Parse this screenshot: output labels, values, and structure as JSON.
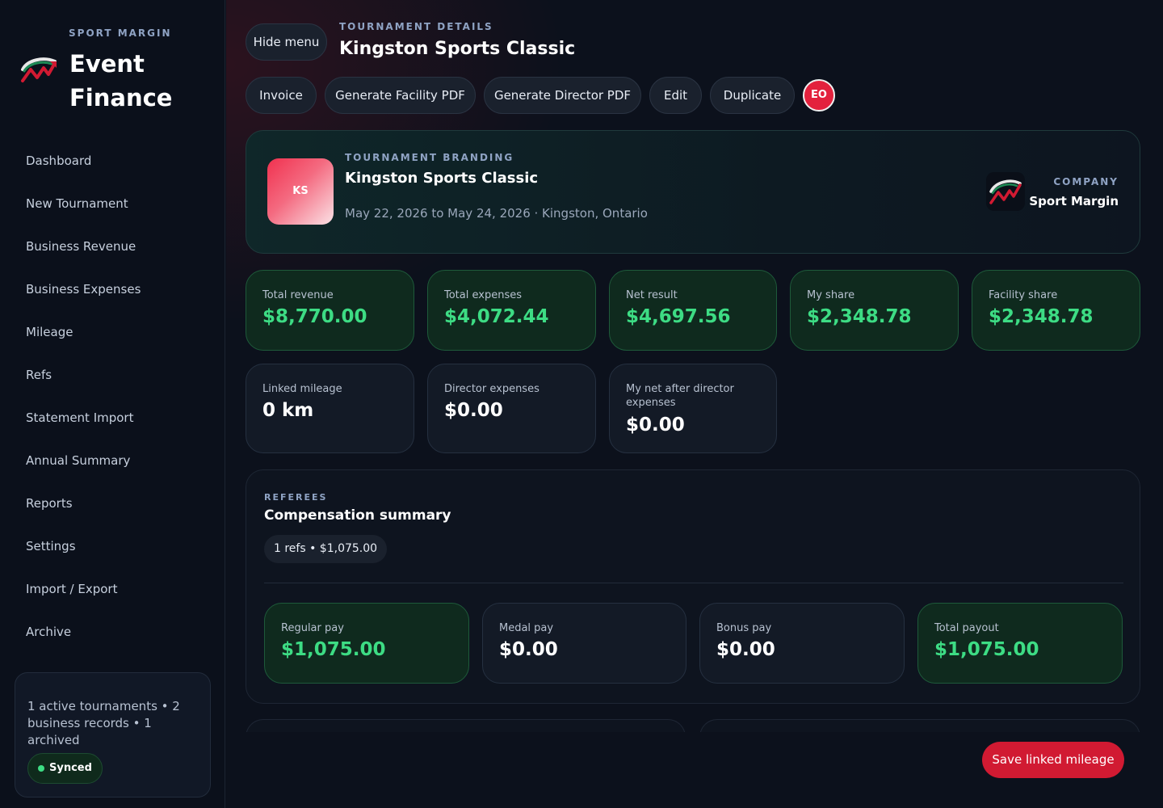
{
  "sidebar": {
    "brand_kicker": "SPORT MARGIN",
    "brand_title": "Event Finance",
    "nav": [
      "Dashboard",
      "New Tournament",
      "Business Revenue",
      "Business Expenses",
      "Mileage",
      "Refs",
      "Statement Import",
      "Annual Summary",
      "Reports",
      "Settings",
      "Import / Export",
      "Archive"
    ],
    "status_text": "1 active tournaments • 2 business records • 1 archived",
    "sync_badge": "Synced"
  },
  "header": {
    "hide_menu": "Hide menu",
    "kicker": "TOURNAMENT DETAILS",
    "title": "Kingston Sports Classic",
    "actions": [
      "Invoice",
      "Generate Facility PDF",
      "Generate Director PDF",
      "Edit",
      "Duplicate"
    ],
    "user_initials": "EO"
  },
  "branding": {
    "logo_initials": "KS",
    "kicker": "TOURNAMENT BRANDING",
    "title": "Kingston Sports Classic",
    "subtitle": "May 22, 2026 to May 24, 2026 · Kingston, Ontario",
    "company_kicker": "COMPANY",
    "company_name": "Sport Margin"
  },
  "stats": [
    {
      "label": "Total revenue",
      "value": "$8,770.00"
    },
    {
      "label": "Total expenses",
      "value": "$4,072.44"
    },
    {
      "label": "Net result",
      "value": "$4,697.56"
    },
    {
      "label": "My share",
      "value": "$2,348.78"
    },
    {
      "label": "Facility share",
      "value": "$2,348.78"
    },
    {
      "label": "Linked mileage",
      "value": "0 km"
    },
    {
      "label": "Director expenses",
      "value": "$0.00"
    },
    {
      "label": "My net after director expenses",
      "value": "$0.00"
    }
  ],
  "referees": {
    "kicker": "REFEREES",
    "title": "Compensation summary",
    "chip": "1 refs • $1,075.00",
    "cards": [
      {
        "label": "Regular pay",
        "value": "$1,075.00"
      },
      {
        "label": "Medal pay",
        "value": "$0.00"
      },
      {
        "label": "Bonus pay",
        "value": "$0.00"
      },
      {
        "label": "Total payout",
        "value": "$1,075.00"
      }
    ]
  },
  "footer": {
    "save_button": "Save linked mileage"
  },
  "colors": {
    "accent_red": "#d11a32",
    "positive_green": "#3ddc84",
    "background": "#0c111c"
  }
}
